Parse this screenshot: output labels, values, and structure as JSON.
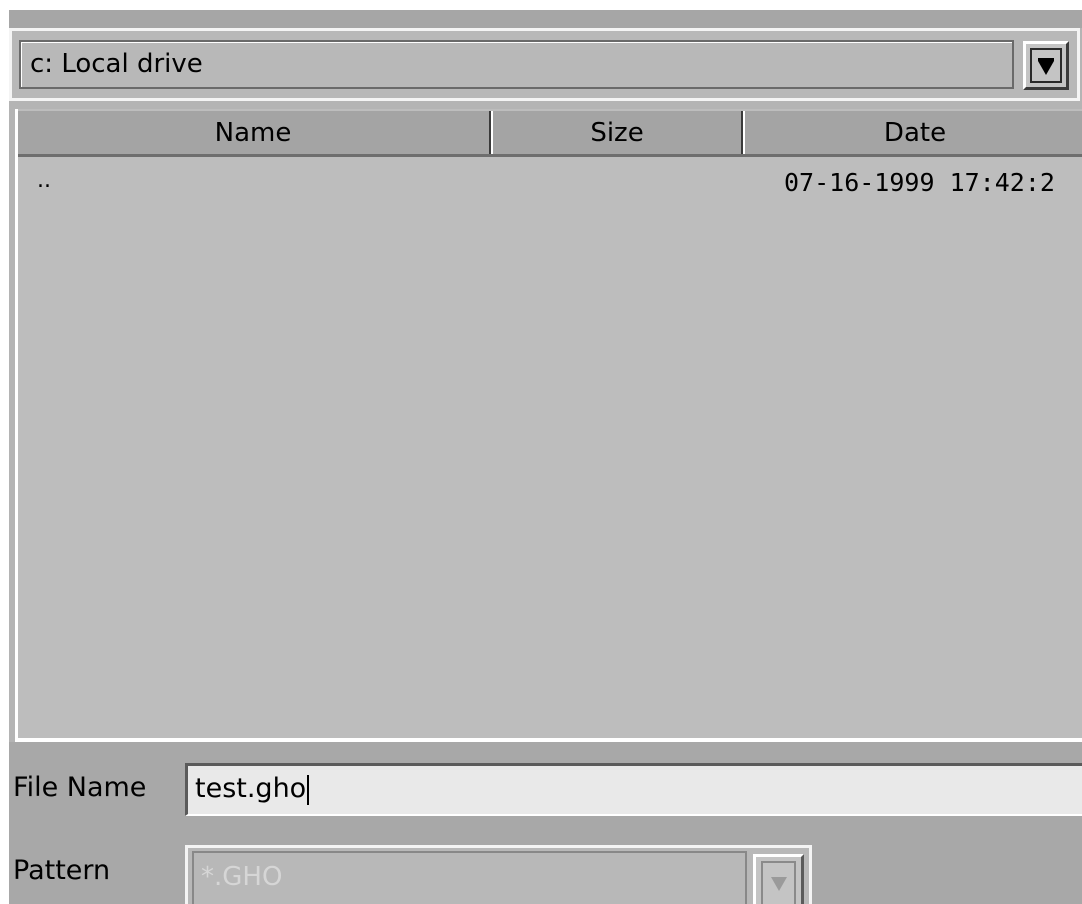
{
  "drive_selector": {
    "value": "c: Local drive",
    "button_icon": "chevron-down-icon"
  },
  "file_list": {
    "columns": [
      "Name",
      "Size",
      "Date"
    ],
    "rows": [
      {
        "name": "..",
        "size": "",
        "date": "07-16-1999 17:42:2"
      }
    ]
  },
  "file_name": {
    "label": "File Name",
    "value": "test.gho"
  },
  "pattern": {
    "label": "Pattern",
    "value": "*.GHO",
    "button_icon": "chevron-down-icon"
  }
}
